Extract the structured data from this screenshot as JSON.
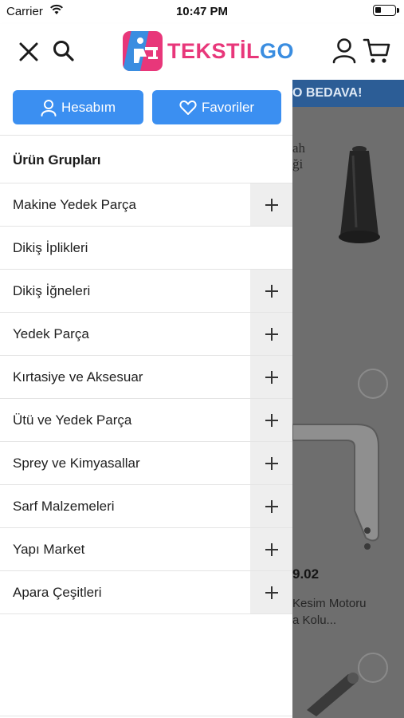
{
  "status_bar": {
    "carrier": "Carrier",
    "time": "10:47 PM",
    "battery_level": 0.3
  },
  "header": {
    "brand_part1": "TEKSTİL",
    "brand_part2": "GO",
    "icons": [
      "close-icon",
      "search-icon",
      "logo",
      "user-icon",
      "cart-icon"
    ]
  },
  "drawer": {
    "account_button": "Hesabım",
    "favorites_button": "Favoriler",
    "section_title": "Ürün Grupları",
    "categories": [
      {
        "label": "Makine Yedek Parça",
        "expandable": true
      },
      {
        "label": "Dikiş İplikleri",
        "expandable": false
      },
      {
        "label": "Dikiş İğneleri",
        "expandable": true
      },
      {
        "label": "Yedek Parça",
        "expandable": true
      },
      {
        "label": "Kırtasiye ve Aksesuar",
        "expandable": true
      },
      {
        "label": "Ütü ve Yedek Parça",
        "expandable": true
      },
      {
        "label": "Sprey ve Kimyasallar",
        "expandable": true
      },
      {
        "label": "Sarf Malzemeleri",
        "expandable": true
      },
      {
        "label": "Yapı Market",
        "expandable": true
      },
      {
        "label": "Apara Çeşitleri",
        "expandable": true
      }
    ]
  },
  "background_page": {
    "promo_text": "O BEDAVA!",
    "snippet_line1": "ah",
    "snippet_line2": "ği",
    "price": "9.02",
    "product_title_line1": "Kesim Motoru",
    "product_title_line2": "a Kolu..."
  },
  "colors": {
    "accent": "#3b8ff1",
    "brand_pink": "#e8377a",
    "brand_blue": "#3a8de0",
    "promo_bar": "#2c5d96"
  }
}
